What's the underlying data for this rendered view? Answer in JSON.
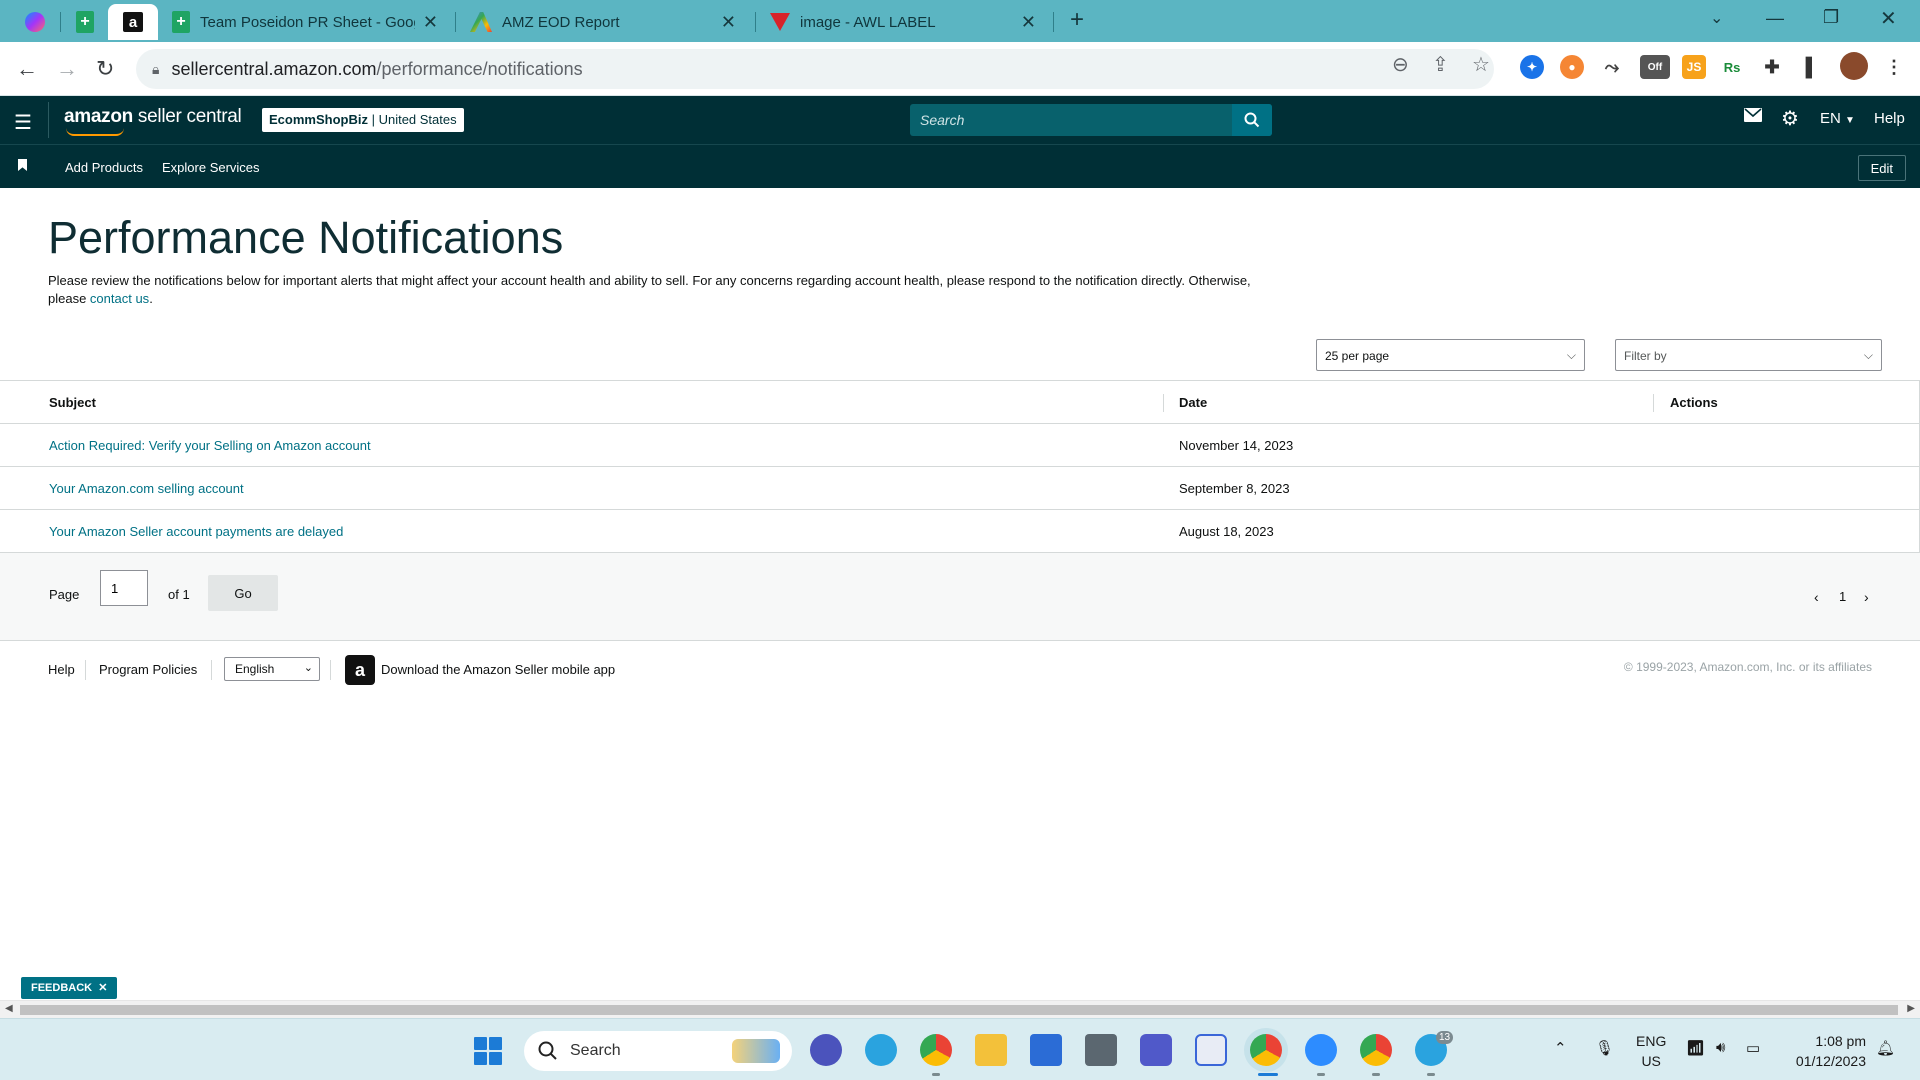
{
  "browser": {
    "tabs": [
      {
        "title": "Team Poseidon PR Sheet - Goog"
      },
      {
        "title": "AMZ EOD Report"
      },
      {
        "title": "image - AWL LABEL"
      }
    ],
    "new_tab_icon": "plus-icon",
    "address": {
      "host": "sellercentral.amazon.com",
      "path": "/performance/notifications"
    },
    "extension_badge": "Off"
  },
  "header": {
    "logo_brand": "amazon",
    "logo_suffix": " seller central",
    "store_name": "EcommShopBiz",
    "store_region": " | United States",
    "search_placeholder": "Search",
    "language": "EN",
    "help": "Help"
  },
  "subnav": {
    "links": [
      "Add Products",
      "Explore Services"
    ],
    "edit": "Edit"
  },
  "page": {
    "title": "Performance Notifications",
    "description": "Please review the notifications below for important alerts that might affect your account health and ability to sell. For any concerns regarding account health, please respond to the notification directly. Otherwise, please ",
    "contact_link": "contact us",
    "contact_suffix": ".",
    "per_page": "25 per page",
    "filter_placeholder": "Filter by"
  },
  "table": {
    "headers": {
      "subject": "Subject",
      "date": "Date",
      "actions": "Actions"
    },
    "rows": [
      {
        "subject": "Action Required: Verify your Selling on Amazon account",
        "date": "November 14, 2023"
      },
      {
        "subject": "Your Amazon.com selling account",
        "date": "September 8, 2023"
      },
      {
        "subject": "Your Amazon Seller account payments are delayed",
        "date": "August 18, 2023"
      }
    ]
  },
  "pagination": {
    "page_label": "Page",
    "page_value": "1",
    "of_label": "of 1",
    "go": "Go",
    "current": "1"
  },
  "footer": {
    "help": "Help",
    "policies": "Program Policies",
    "language": "English",
    "app_text": "Download the Amazon Seller mobile app",
    "copyright": "© 1999-2023, Amazon.com, Inc. or its affiliates"
  },
  "feedback": "FEEDBACK",
  "taskbar": {
    "search": "Search",
    "lang_top": "ENG",
    "lang_bottom": "US",
    "time": "1:08 pm",
    "date": "01/12/2023",
    "telegram_badge": "13"
  },
  "colors": {
    "tabstrip": "#5bb5c2",
    "sc_header": "#002f36",
    "link": "#007185",
    "accent": "#ff9900"
  }
}
